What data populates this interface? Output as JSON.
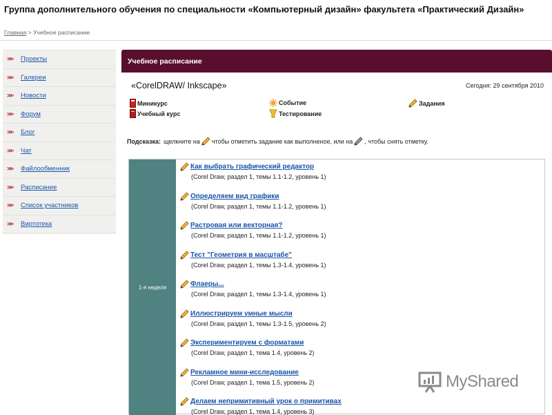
{
  "page": {
    "title": "Группа дополнительного обучения по специальности «Компьютерный дизайн» факультета «Практический Дизайн»"
  },
  "breadcrumb": {
    "home": "Главная",
    "separator": ">",
    "current": "Учебное расписание"
  },
  "sidebar": {
    "items": [
      {
        "label": "Проекты"
      },
      {
        "label": "Галереи"
      },
      {
        "label": "Новости"
      },
      {
        "label": "Форум"
      },
      {
        "label": "Блог"
      },
      {
        "label": "Чат"
      },
      {
        "label": "Файлообменник"
      },
      {
        "label": "Расписание"
      },
      {
        "label": "Список участников"
      },
      {
        "label": "Виртотека"
      }
    ],
    "arrow_icon": "triple-chevron-right"
  },
  "main": {
    "header": "Учебное расписание",
    "course_title": "«CorelDRAW/ Inkscape»",
    "today": "Сегодня: 29 сентября 2010",
    "legend": {
      "minicourse": "Миникурс",
      "course": "Учебный курс",
      "event": "Событие",
      "testing": "Тестирование",
      "tasks": "Задания"
    },
    "hint": {
      "bold": "Подсказка:",
      "part1": "щелкните на",
      "part2": "чтобы отметить задание как выполненое, или на",
      "part3": ", чтобы снять отметку."
    },
    "week_label": "1-я неделя",
    "tasks": [
      {
        "title": "Как выбрать графический редактор",
        "meta": "(Corel Draw, раздел 1, темы 1.1-1.2, уровень 1)"
      },
      {
        "title": "Определяем вид графики",
        "meta": "(Corel Draw, раздел 1, темы 1.1-1.2, уровень 1)"
      },
      {
        "title": "Растровая или векторная?",
        "meta": "(Corel Draw, раздел 1, темы 1.1-1.2, уровень 1)"
      },
      {
        "title": "Тест \"Геометрия в масштабе\"",
        "meta": "(Corel Draw, раздел 1, темы 1.3-1.4, уровень 1)"
      },
      {
        "title": "Флаеры...",
        "meta": "(Corel Draw, раздел 1, темы 1.3-1.4, уровень 1)"
      },
      {
        "title": "Иллюстрируем умные мысли",
        "meta": "(Corel Draw, раздел 1, темы 1.3-1.5, уровень 2)"
      },
      {
        "title": "Экспериментируем с форматами",
        "meta": "(Corel Draw, раздел 1, тема 1.4, уровень 2)"
      },
      {
        "title": "Рекламное мини-исследование",
        "meta": "(Corel Draw, раздел 1, тема 1.5, уровень 2)"
      },
      {
        "title": "Делаем непримитивный урок о примитивах",
        "meta": "(Corel Draw, раздел 1, тема 1.4, уровень 3)"
      }
    ]
  },
  "watermark": {
    "text": "MyShared"
  },
  "colors": {
    "header_bg": "#5a0e2d",
    "week_cell_bg": "#4f8281",
    "link": "#1a55a8",
    "sidebar_bg": "#f0f0ee",
    "arrow": "#b02c2c"
  }
}
